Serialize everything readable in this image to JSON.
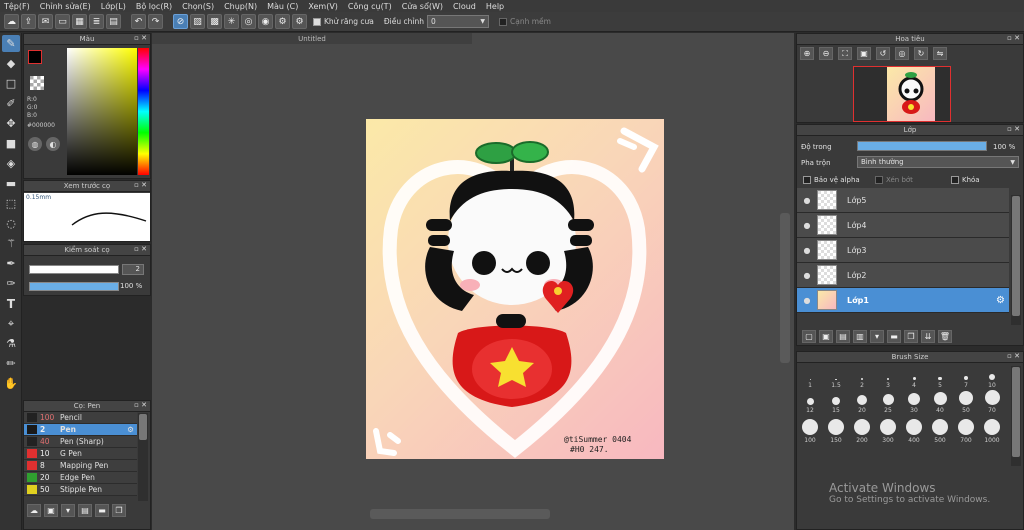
{
  "menu": [
    "Tệp(F)",
    "Chỉnh sửa(E)",
    "Lớp(L)",
    "Bộ lọc(R)",
    "Chọn(S)",
    "Chụp(N)",
    "Màu (C)",
    "Xem(V)",
    "Công cụ(T)",
    "Cửa sổ(W)",
    "Cloud",
    "Help"
  ],
  "toolbar": {
    "antialias_label": "Khử răng cưa",
    "adjust_label": "Điều chỉnh",
    "adjust_value": "0",
    "soft_edge_label": "Cạnh mềm"
  },
  "color_panel": {
    "title": "Màu",
    "r": "R:0",
    "g": "G:0",
    "b": "B:0",
    "hex": "#000000"
  },
  "brush_preview": {
    "title": "Xem trước cọ",
    "size": "0.15mm"
  },
  "brush_control": {
    "title": "Kiểm soát cọ",
    "size_value": "2",
    "opacity_value": "100 %"
  },
  "brush_list": {
    "title": "Cọ: Pen",
    "items": [
      {
        "size": "100",
        "name": "Pencil",
        "color": "#222222"
      },
      {
        "size": "2",
        "name": "Pen",
        "color": "#1a1a1a"
      },
      {
        "size": "40",
        "name": "Pen (Sharp)",
        "color": "#222222"
      },
      {
        "size": "10",
        "name": "G Pen",
        "color": "#e03030"
      },
      {
        "size": "8",
        "name": "Mapping Pen",
        "color": "#e03030"
      },
      {
        "size": "20",
        "name": "Edge Pen",
        "color": "#30a030"
      },
      {
        "size": "50",
        "name": "Stipple Pen",
        "color": "#e0d020"
      }
    ]
  },
  "canvas": {
    "tab_title": "Untitled",
    "signature_line1": "@tiSummer 0404",
    "signature_line2": "#H0 247."
  },
  "navigator": {
    "title": "Hoa tiêu"
  },
  "layers_panel": {
    "title": "Lớp",
    "opacity_label": "Độ trong",
    "opacity_value": "100 %",
    "opacity_fraction": 1.0,
    "blend_label": "Pha trộn",
    "blend_value": "Bình thường",
    "protect_alpha": "Bảo vệ alpha",
    "clipping": "Xén bớt",
    "lock": "Khóa",
    "layers": [
      "Lớp5",
      "Lớp4",
      "Lớp3",
      "Lớp2",
      "Lớp1"
    ]
  },
  "brush_size": {
    "title": "Brush Size",
    "sizes": [
      "1",
      "1.5",
      "2",
      "3",
      "4",
      "5",
      "7",
      "10",
      "12",
      "15",
      "20",
      "25",
      "30",
      "40",
      "50",
      "70",
      "100",
      "150",
      "200",
      "300",
      "400",
      "500",
      "700",
      "1000"
    ]
  },
  "watermark": {
    "line1": "Activate Windows",
    "line2": "Go to Settings to activate Windows."
  }
}
